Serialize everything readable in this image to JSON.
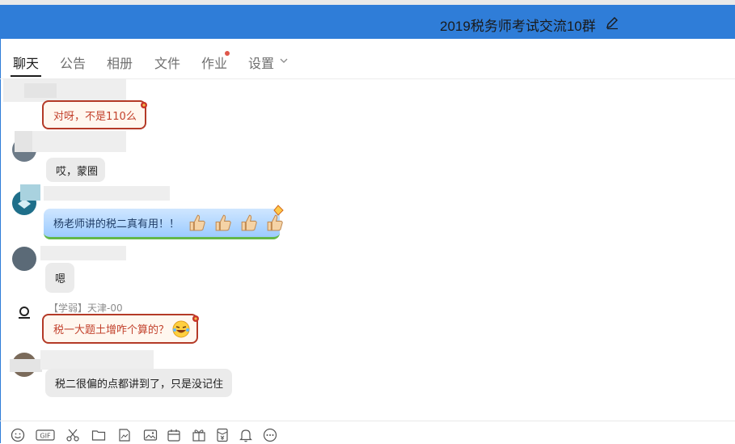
{
  "header": {
    "title": "2019税务师考试交流10群"
  },
  "tabs": [
    {
      "label": "聊天",
      "active": true
    },
    {
      "label": "公告"
    },
    {
      "label": "相册"
    },
    {
      "label": "文件"
    },
    {
      "label": "作业",
      "badge": true
    },
    {
      "label": "设置",
      "dropdown": true
    }
  ],
  "messages": [
    {
      "text": "对呀，不是110么",
      "style": "red"
    },
    {
      "text": "哎，蒙圈",
      "style": "plain"
    },
    {
      "text": "杨老师讲的税二真有用！！",
      "style": "blue",
      "emoji": "thumbs-up-icon x4"
    },
    {
      "text": "嗯",
      "style": "plain"
    },
    {
      "sender": "【学弱】天津-00",
      "text": "税一大题土增咋个算的？",
      "style": "red",
      "emoji": "laughing-face-icon"
    },
    {
      "text": "税二很偏的点都讲到了，只是没记住",
      "style": "plain"
    }
  ],
  "colors": {
    "titlebar": "#2f7dd8",
    "red_border": "#b43a27",
    "badge": "#e0574a"
  },
  "toolbar": {
    "icons": [
      "emoji-icon",
      "gif-icon",
      "scissors-icon",
      "folder-icon",
      "image-file-icon",
      "picture-icon",
      "calendar-icon",
      "gift-icon",
      "red-packet-icon",
      "bell-icon",
      "more-icon"
    ],
    "gif_label": "GIF"
  }
}
